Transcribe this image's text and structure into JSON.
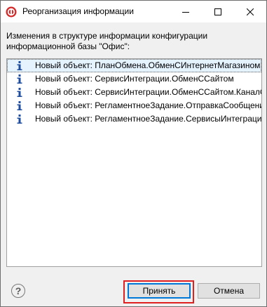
{
  "window": {
    "title": "Реорганизация информации",
    "accent": "#0078d7"
  },
  "description": "Изменения в структуре информации конфигурации информационной базы \"Офис\":",
  "list": {
    "items": [
      {
        "icon": "info-icon",
        "text": "Новый объект: ПланОбмена.ОбменСИнтернетМагазином"
      },
      {
        "icon": "info-icon",
        "text": "Новый объект: СервисИнтеграции.ОбменССайтом"
      },
      {
        "icon": "info-icon",
        "text": "Новый объект: СервисИнтеграции.ОбменССайтом.КаналСервисаИнтеграции"
      },
      {
        "icon": "info-icon",
        "text": "Новый объект: РегламентноеЗадание.ОтправкаСообщенийСервисовИнтеграции"
      },
      {
        "icon": "info-icon",
        "text": "Новый объект: РегламентноеЗадание.СервисыИнтеграцииОбработкаСообщений"
      }
    ]
  },
  "buttons": {
    "help": "?",
    "accept": "Принять",
    "cancel": "Отмена"
  },
  "colors": {
    "highlight_frame": "#e02020",
    "selection": "#e5f3ff"
  }
}
